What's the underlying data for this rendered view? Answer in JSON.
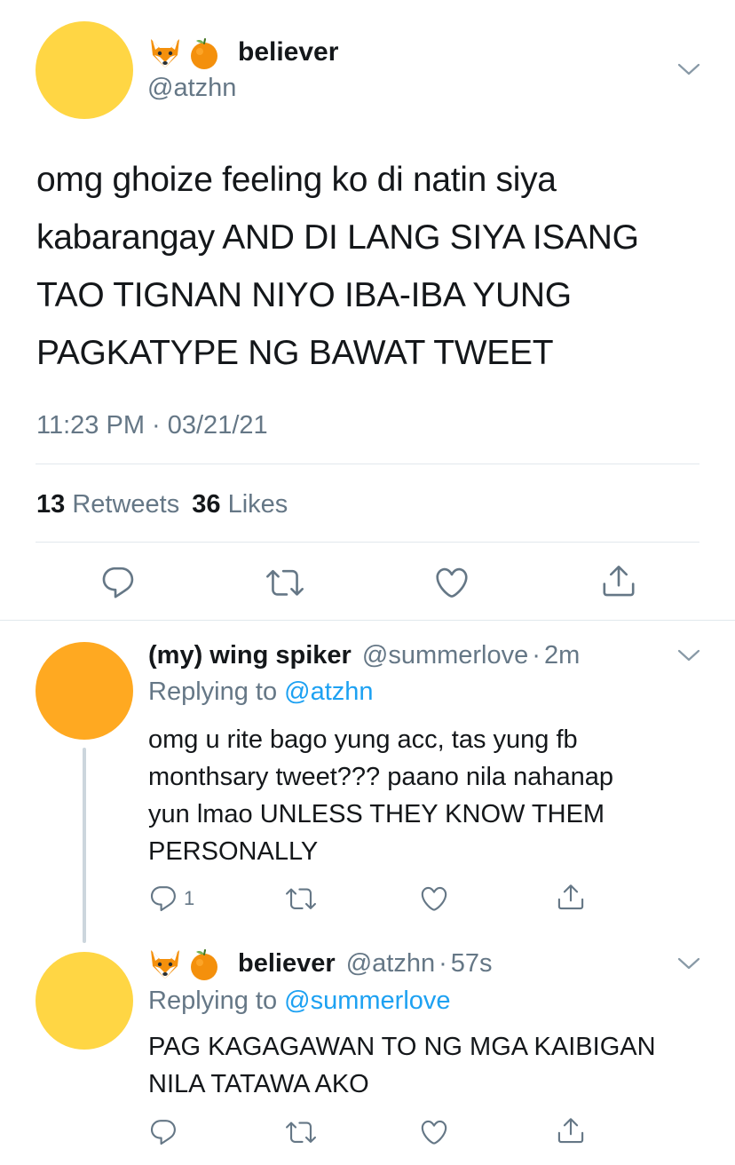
{
  "main_tweet": {
    "display_name": "believer",
    "handle": "@atzhn",
    "name_emojis": [
      "fox-emoji",
      "tangerine-emoji"
    ],
    "text_lines": [
      "omg ghoize feeling ko di natin siya",
      "kabarangay AND DI LANG SIYA ISANG",
      "TAO TIGNAN NIYO IBA-IBA YUNG",
      "PAGKATYPE NG BAWAT TWEET"
    ],
    "timestamp": "11:23 PM · 03/21/21",
    "retweets_count": "13",
    "retweets_label": "Retweets",
    "likes_count": "36",
    "likes_label": "Likes",
    "avatar_color": "#FFD644"
  },
  "replies": [
    {
      "display_name": "(my) wing spiker",
      "handle": "@summerlove",
      "separator": "·",
      "time": "2m",
      "replying_prefix": "Replying to",
      "replying_handle": "@atzhn",
      "text_lines": [
        "omg u rite bago yung acc, tas yung fb",
        "monthsary tweet??? paano nila nahanap",
        "yun lmao UNLESS THEY KNOW THEM",
        "PERSONALLY"
      ],
      "reply_count": "1",
      "avatar_color": "#FFA921"
    },
    {
      "display_name": "believer",
      "handle": "@atzhn",
      "separator": "·",
      "time": "57s",
      "replying_prefix": "Replying to",
      "replying_handle": "@summerlove",
      "text_lines": [
        "PAG KAGAGAWAN TO NG MGA KAIBIGAN",
        "NILA TATAWA AKO"
      ],
      "reply_count": "",
      "avatar_color": "#FFD644"
    }
  ],
  "colors": {
    "accent": "#1DA1F2",
    "secondary_text": "#657786",
    "divider": "#E1E8ED",
    "icon": "#657786"
  },
  "icons": [
    "reply-icon",
    "retweet-icon",
    "like-icon",
    "share-icon",
    "chevron-down-icon"
  ]
}
